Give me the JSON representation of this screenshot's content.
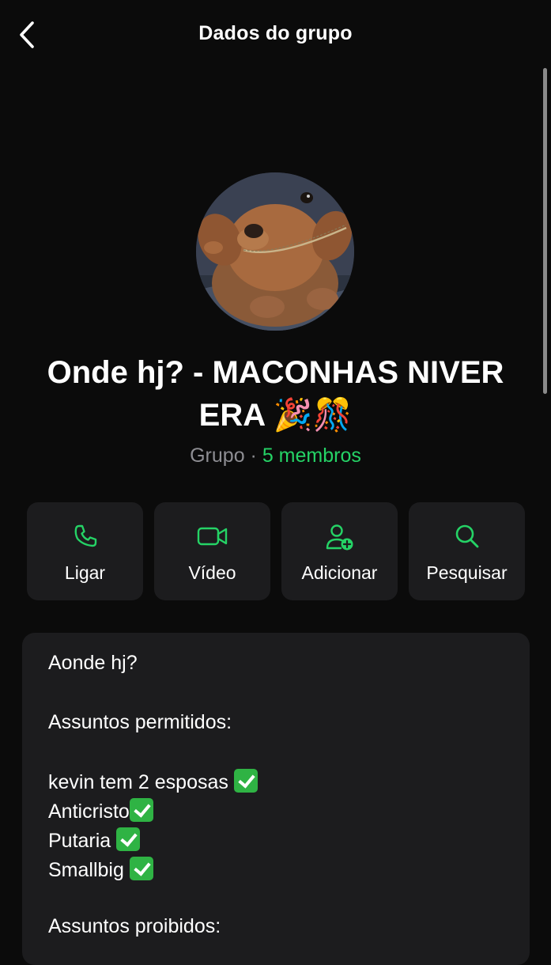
{
  "header": {
    "back_icon": "chevron-left-icon",
    "title": "Dados do grupo"
  },
  "group": {
    "avatar": "group-avatar-dog-photo",
    "name": "Onde hj? - MACONHAS NIVER ERA 🎉🎊",
    "type_label": "Grupo",
    "separator": "·",
    "members_label": "5 membros"
  },
  "actions": [
    {
      "label": "Ligar",
      "icon": "phone-icon"
    },
    {
      "label": "Vídeo",
      "icon": "video-camera-icon"
    },
    {
      "label": "Adicionar",
      "icon": "add-person-icon"
    },
    {
      "label": "Pesquisar",
      "icon": "search-icon"
    }
  ],
  "description": {
    "lines": [
      "Aonde hj?",
      "Assuntos permitidos:",
      "kevin tem 2 esposas",
      "Anticristo",
      "Putaria",
      "Smallbig",
      "Assuntos proibidos:"
    ],
    "check_icon": "check-mark-emoji-icon"
  },
  "colors": {
    "background": "#0b0b0b",
    "card": "#1c1c1e",
    "accent_green": "#25d366",
    "secondary_text": "#8e8e93",
    "check_green": "#2fb344"
  }
}
